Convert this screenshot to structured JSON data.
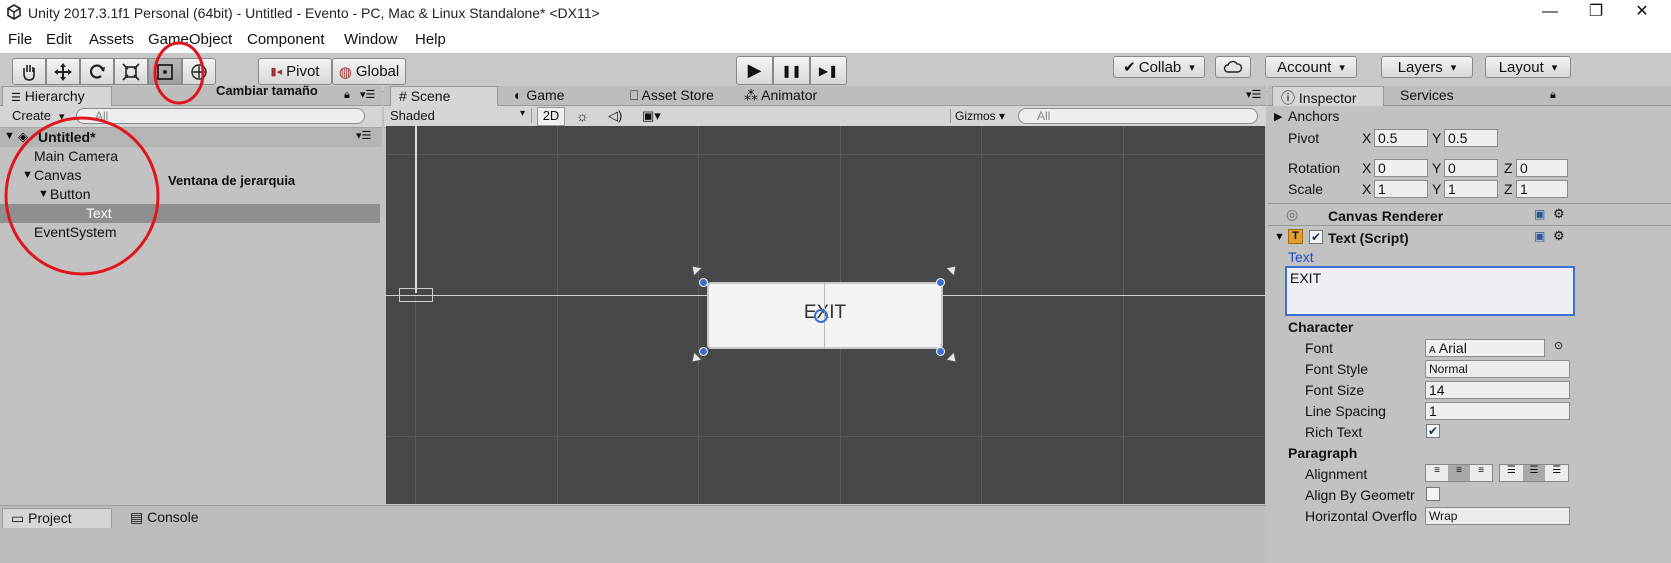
{
  "window": {
    "title": "Unity 2017.3.1f1 Personal (64bit) - Untitled - Evento - PC, Mac & Linux Standalone* <DX11>",
    "minimize": "—",
    "restore": "❐",
    "close": "✕"
  },
  "menu": [
    "File",
    "Edit",
    "Assets",
    "GameObject",
    "Component",
    "Window",
    "Help"
  ],
  "toolbar": {
    "tools": [
      "hand-icon",
      "move-icon",
      "rotate-icon",
      "scale-icon",
      "rect-tool-icon",
      "transform-icon"
    ],
    "pivot": "Pivot",
    "global": "Global",
    "play": "▶",
    "pause": "❚❚",
    "step": "▶❚",
    "collab": "Collab",
    "account": "Account",
    "layers": "Layers",
    "layout": "Layout"
  },
  "annotations": {
    "resize": "Cambiar tamaño",
    "hierarchy": "Ventana de jerarquia"
  },
  "hierarchy": {
    "tab": "Hierarchy",
    "create": "Create",
    "search_placeholder": "All",
    "scene": "Untitled*",
    "items": [
      {
        "label": "Main Camera",
        "indent": 0,
        "arrow": ""
      },
      {
        "label": "Canvas",
        "indent": 0,
        "arrow": "▼"
      },
      {
        "label": "Button",
        "indent": 1,
        "arrow": "▼"
      },
      {
        "label": "Text",
        "indent": 2,
        "arrow": "",
        "selected": true
      },
      {
        "label": "EventSystem",
        "indent": 0,
        "arrow": ""
      }
    ]
  },
  "scene_tabs": [
    "Scene",
    "Game",
    "Asset Store",
    "Animator"
  ],
  "scene_toolbar": {
    "shading": "Shaded",
    "mode2d": "2D",
    "gizmos": "Gizmos",
    "search_placeholder": "All"
  },
  "scene_view": {
    "button_text": "EXIT"
  },
  "inspector": {
    "tabs": [
      "Inspector",
      "Services"
    ],
    "anchors": "Anchors",
    "pivot": {
      "label": "Pivot",
      "x": "0.5",
      "y": "0.5"
    },
    "rotation": {
      "label": "Rotation",
      "x": "0",
      "y": "0",
      "z": "0"
    },
    "scale": {
      "label": "Scale",
      "x": "1",
      "y": "1",
      "z": "1"
    },
    "canvas_renderer": "Canvas Renderer",
    "text_script": "Text (Script)",
    "text_label": "Text",
    "text_value": "EXIT",
    "character": "Character",
    "font": {
      "label": "Font",
      "value": "Arial"
    },
    "font_style": {
      "label": "Font Style",
      "value": "Normal"
    },
    "font_size": {
      "label": "Font Size",
      "value": "14"
    },
    "line_spacing": {
      "label": "Line Spacing",
      "value": "1"
    },
    "rich_text": {
      "label": "Rich Text",
      "checked": true
    },
    "paragraph": "Paragraph",
    "alignment": "Alignment",
    "align_geometry": "Align By Geometr",
    "horizontal_overflow": {
      "label": "Horizontal Overflo",
      "value": "Wrap"
    }
  },
  "bottom_tabs": [
    "Project",
    "Console"
  ],
  "colors": {
    "annotation": "#e0161c",
    "selection_blue": "#3b6fd6",
    "scene_bg": "#474747"
  }
}
